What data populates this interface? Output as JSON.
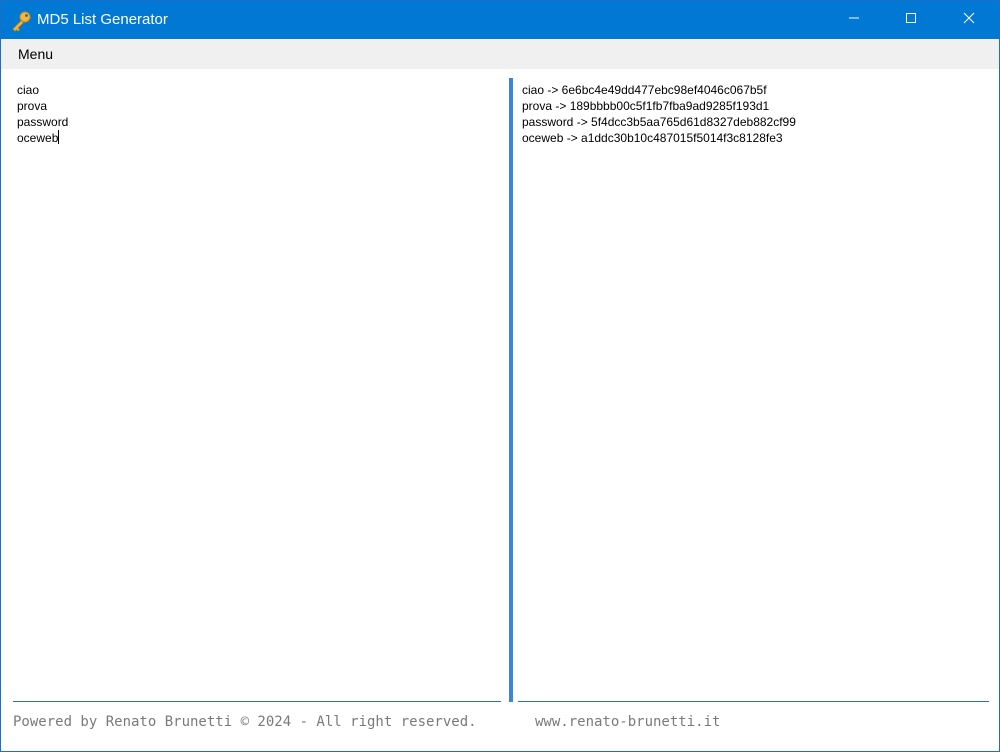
{
  "window": {
    "title": "MD5 List Generator",
    "icon": "key-icon",
    "controls": [
      "minimize-icon",
      "maximize-icon",
      "close-icon"
    ]
  },
  "menubar": {
    "items": [
      {
        "label": "Menu"
      }
    ]
  },
  "input_pane": {
    "lines": [
      "ciao",
      "prova",
      "password",
      "oceweb"
    ]
  },
  "output_pane": {
    "lines": [
      "ciao -> 6e6bc4e49dd477ebc98ef4046c067b5f",
      "prova -> 189bbbb00c5f1fb7fba9ad9285f193d1",
      "password -> 5f4dcc3b5aa765d61d8327deb882cf99",
      "oceweb -> a1ddc30b10c487015f5014f3c8128fe3"
    ]
  },
  "footer": {
    "copyright": "Powered by Renato Brunetti © 2024 - All right reserved.",
    "website": "www.renato-brunetti.it"
  },
  "colors": {
    "titlebar": "#0078d4",
    "menubar": "#f0f0f0",
    "splitter": "#3a86d8",
    "footer_text": "#7a7a7a"
  }
}
